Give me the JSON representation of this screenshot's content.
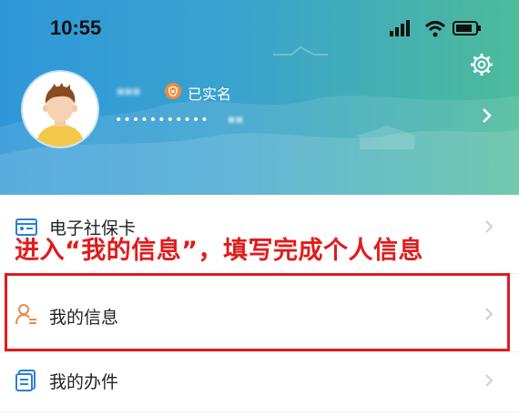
{
  "status_bar": {
    "time": "10:55",
    "icons": [
      "signal-icon",
      "wifi-icon",
      "battery-icon"
    ]
  },
  "header": {
    "settings_icon": "gear-icon",
    "avatar_icon": "avatar",
    "verify_icon": "verified-badge-icon",
    "verify_label": "已实名",
    "id_masked": "•••••••••••",
    "colors": {
      "gradient_start": "#2f97d8",
      "gradient_end": "#4dbb9a"
    }
  },
  "menu": {
    "items": [
      {
        "label": "电子社保卡",
        "icon": "social-security-card-icon"
      },
      {
        "label": "我的信息",
        "icon": "user-info-icon"
      },
      {
        "label": "我的办件",
        "icon": "documents-icon"
      }
    ]
  },
  "annotation": {
    "text": "进入“我的信息”，填写完成个人信息",
    "color": "#e01c1c"
  }
}
